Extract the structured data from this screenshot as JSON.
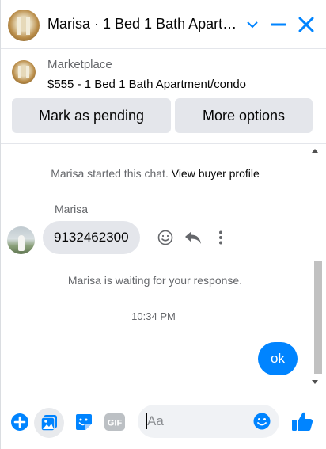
{
  "header": {
    "title": "Marisa · 1 Bed 1 Bath Apartment/condo",
    "icons": [
      "listing-avatar",
      "chevron-down-icon",
      "minimize-icon",
      "close-icon"
    ]
  },
  "listing": {
    "source_label": "Marketplace",
    "price_title": "$555 - 1 Bed 1 Bath Apartment/condo",
    "primary_button": "Mark as pending",
    "secondary_button": "More options"
  },
  "messages": {
    "intro_text": "Marisa started this chat.",
    "intro_link": "View buyer profile",
    "sender_name": "Marisa",
    "incoming_text": "9132462300",
    "waiting_text": "Marisa is waiting for your response.",
    "timestamp": "10:34 PM",
    "outgoing_text": "ok"
  },
  "composer": {
    "placeholder": "Aa",
    "value": "",
    "icons": [
      "add-icon",
      "photo-icon",
      "sticker-icon",
      "gif-icon",
      "emoji-icon",
      "like-icon"
    ]
  },
  "colors": {
    "accent": "#0084ff",
    "button_bg": "#e4e6eb",
    "secondary_text": "#65676b"
  }
}
